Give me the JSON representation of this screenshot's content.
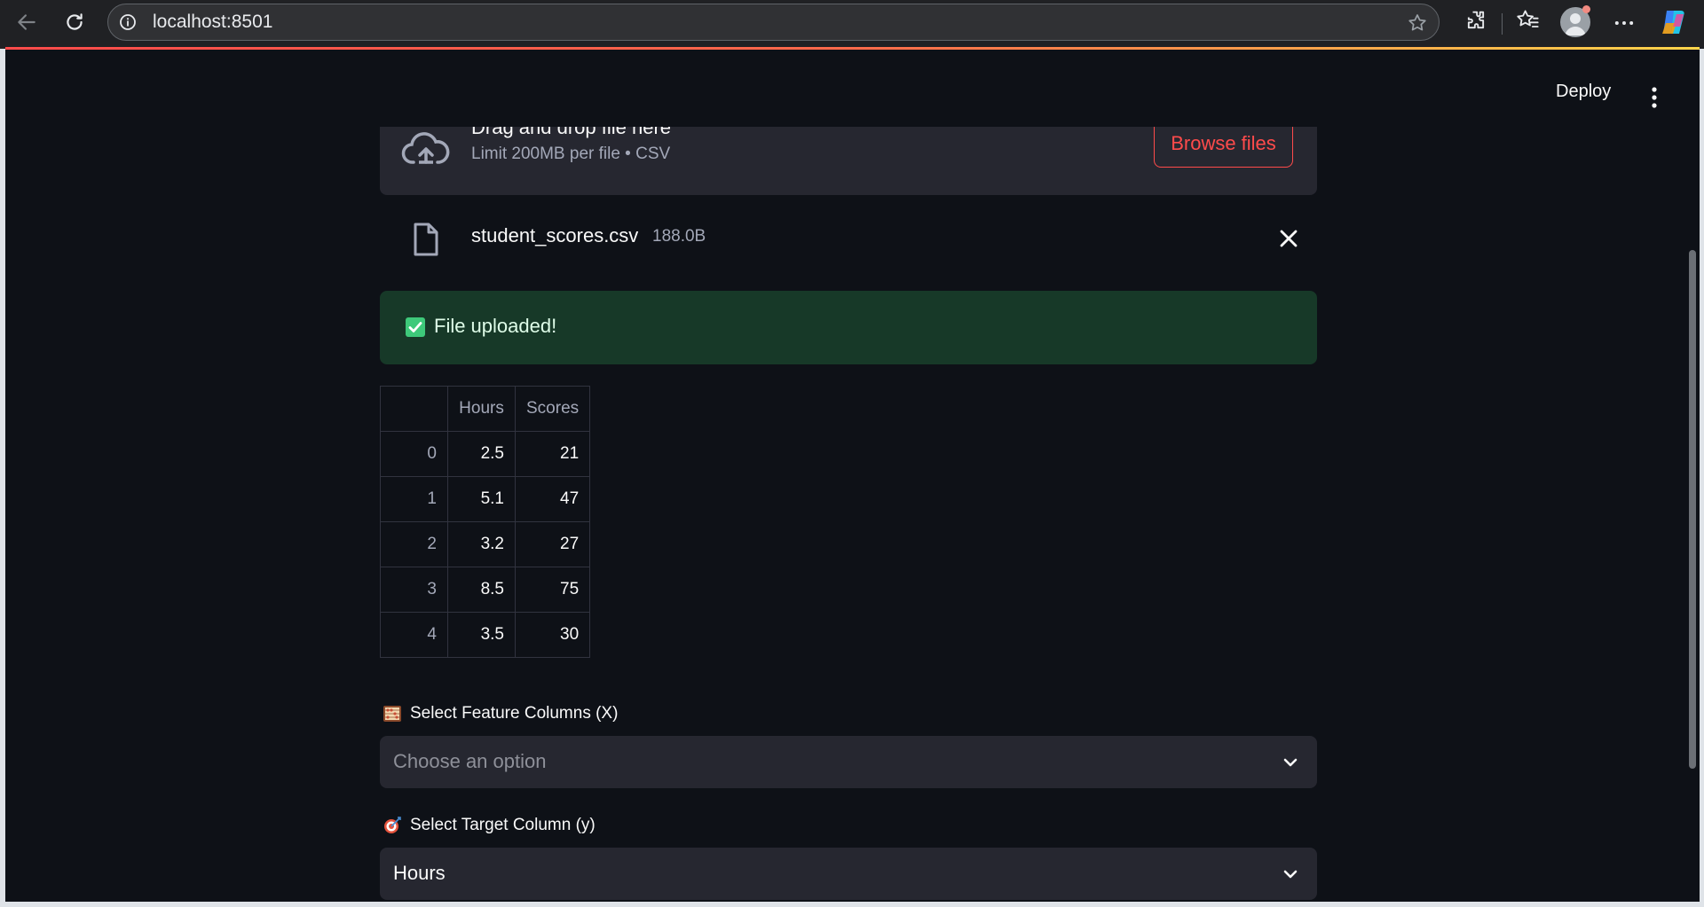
{
  "browser": {
    "url": "localhost:8501"
  },
  "app": {
    "deploy_label": "Deploy"
  },
  "uploader": {
    "title": "Drag and drop file here",
    "limit": "Limit 200MB per file • CSV",
    "browse_label": "Browse files"
  },
  "file": {
    "name": "student_scores.csv",
    "size": "188.0B"
  },
  "success": {
    "message": "File uploaded!"
  },
  "table": {
    "headers": [
      "",
      "Hours",
      "Scores"
    ],
    "rows": [
      {
        "index": "0",
        "hours": "2.5",
        "scores": "21"
      },
      {
        "index": "1",
        "hours": "5.1",
        "scores": "47"
      },
      {
        "index": "2",
        "hours": "3.2",
        "scores": "27"
      },
      {
        "index": "3",
        "hours": "8.5",
        "scores": "75"
      },
      {
        "index": "4",
        "hours": "3.5",
        "scores": "30"
      }
    ]
  },
  "feature_select": {
    "label": "Select Feature Columns (X)",
    "placeholder": "Choose an option"
  },
  "target_select": {
    "label": "Select Target Column (y)",
    "value": "Hours"
  },
  "colors": {
    "accent": "#ff4b4b",
    "background": "#0e1117",
    "widget": "#262730",
    "success_bg": "#173928"
  }
}
